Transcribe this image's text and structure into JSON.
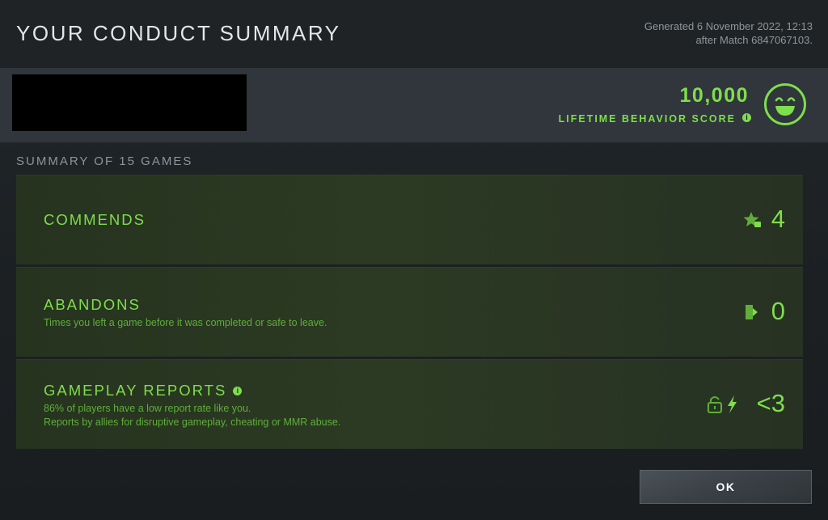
{
  "header": {
    "title": "YOUR CONDUCT SUMMARY",
    "generated_line1": "Generated 6 November 2022, 12:13",
    "generated_line2": "after Match 6847067103."
  },
  "profile": {
    "score_value": "10,000",
    "score_label": "LIFETIME BEHAVIOR SCORE",
    "info_glyph": "i",
    "smiley_icon": "grinning-face-icon"
  },
  "summary": {
    "title": "SUMMARY OF 15 GAMES",
    "cards": [
      {
        "heading": "COMMENDS",
        "value": "4",
        "icon": "star-thumb-icon"
      },
      {
        "heading": "ABANDONS",
        "subtext": "Times you left a game before it was completed or safe to leave.",
        "value": "0",
        "icon": "exit-door-icon"
      },
      {
        "heading": "GAMEPLAY REPORTS",
        "info_glyph": "i",
        "subtext_line1": "86% of players have a low report rate like you.",
        "subtext_line2": "Reports by allies for disruptive gameplay, cheating or MMR abuse.",
        "value": "<3",
        "icon": "lock-lightning-icon"
      }
    ]
  },
  "ok_label": "OK",
  "colors": {
    "accent": "#7ede4c",
    "card_bg": "#2b3922",
    "page_bg": "#1d2124"
  }
}
